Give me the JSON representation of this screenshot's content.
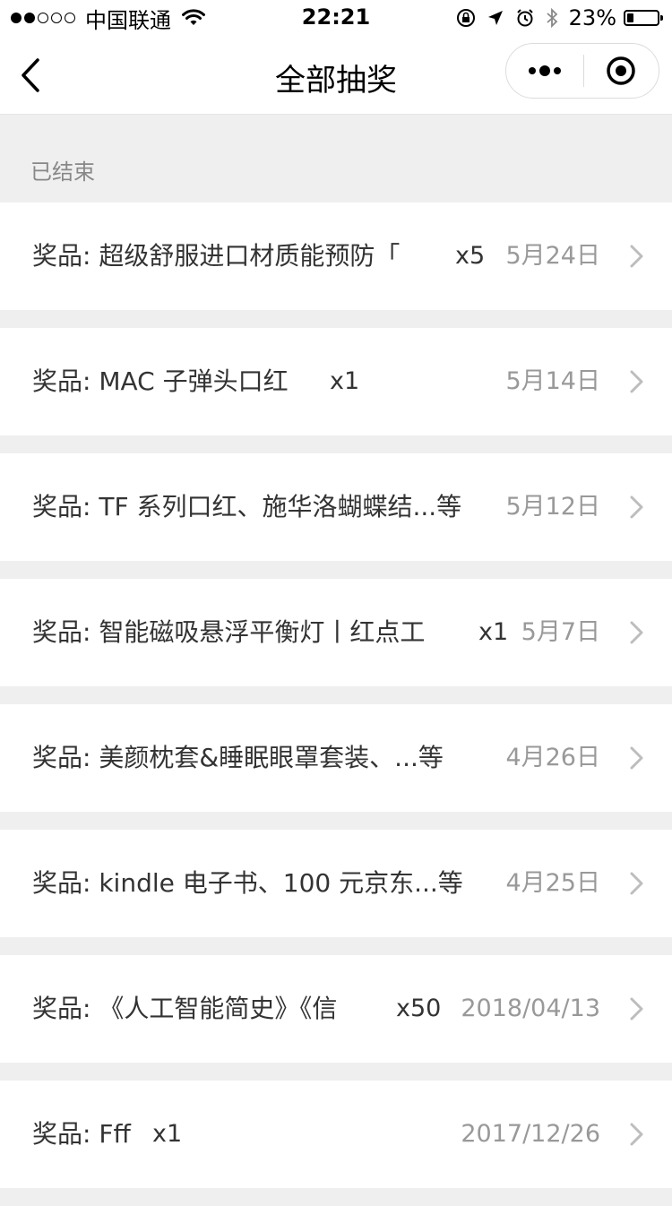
{
  "status_bar": {
    "carrier": "中国联通",
    "time": "22:21",
    "battery": "23%",
    "battery_level": 0.23,
    "signal_bars": 2,
    "signal_total": 5
  },
  "nav": {
    "title": "全部抽奖"
  },
  "section": {
    "label": "已结束"
  },
  "items": [
    {
      "prefix": "奖品:",
      "name": "超级舒服进口材质能预防「",
      "qty": "x5",
      "date": "5月24日"
    },
    {
      "prefix": "奖品:",
      "name": "MAC 子弹头口红",
      "qty": "x1",
      "date": "5月14日"
    },
    {
      "prefix": "奖品:",
      "name": "TF 系列口红、施华洛蝴蝶结...等",
      "qty": "",
      "date": "5月12日"
    },
    {
      "prefix": "奖品:",
      "name": "智能磁吸悬浮平衡灯丨红点工",
      "qty": "x1",
      "date": "5月7日"
    },
    {
      "prefix": "奖品:",
      "name": "美颜枕套&睡眠眼罩套装、...等",
      "qty": "",
      "date": "4月26日"
    },
    {
      "prefix": "奖品:",
      "name": "kindle 电子书、100 元京东...等",
      "qty": "",
      "date": "4月25日"
    },
    {
      "prefix": "奖品:",
      "name": "《人工智能简史》《信",
      "qty": "x50",
      "date": "2018/04/13"
    },
    {
      "prefix": "奖品:",
      "name": "Fff",
      "qty": "x1",
      "date": "2017/12/26"
    }
  ]
}
